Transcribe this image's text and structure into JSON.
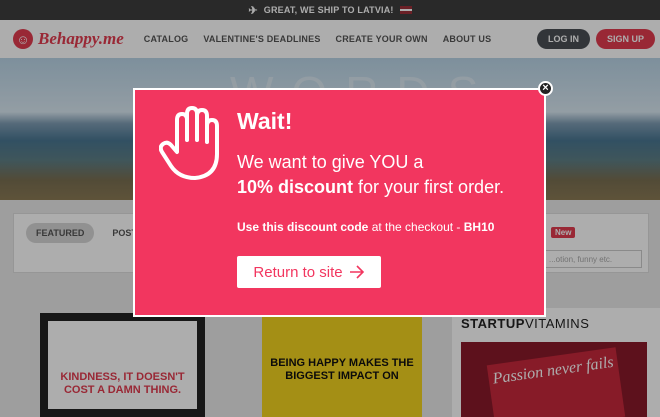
{
  "promo": {
    "icon": "airplane-icon",
    "text": "GREAT, WE SHIP TO LATVIA!",
    "flag": "latvia-flag-icon"
  },
  "header": {
    "logo_text": "Behappy.me",
    "nav": [
      "CATALOG",
      "VALENTINE'S DEADLINES",
      "CREATE YOUR OWN",
      "ABOUT US"
    ],
    "login_label": "LOG IN",
    "signup_label": "SIGN UP"
  },
  "hero": {
    "word": "WORDS"
  },
  "content": {
    "tabs": [
      "FEATURED",
      "POSTERS"
    ],
    "new_badge": "New",
    "search_placeholder": "...otion, funny etc."
  },
  "products": {
    "poster1_text": "KINDNESS, IT DOESN'T COST A DAMN THING.",
    "poster2_text": "BEING HAPPY MAKES THE BIGGEST IMPACT ON",
    "startup_brand_1": "STARTUP",
    "startup_brand_2": "VITAMINS",
    "startup_sign": "Passion never fails"
  },
  "modal": {
    "title": "Wait!",
    "line1": "We want to give YOU a",
    "line2_bold": "10% discount",
    "line2_rest": " for your first order.",
    "code_bold": "Use this discount code",
    "code_mid": " at the checkout - ",
    "code_value": "BH10",
    "return_label": "Return to site",
    "close_symbol": "×"
  },
  "colors": {
    "accent": "#f2365f",
    "brand": "#e23b4f",
    "dark": "#3d3d3d"
  }
}
